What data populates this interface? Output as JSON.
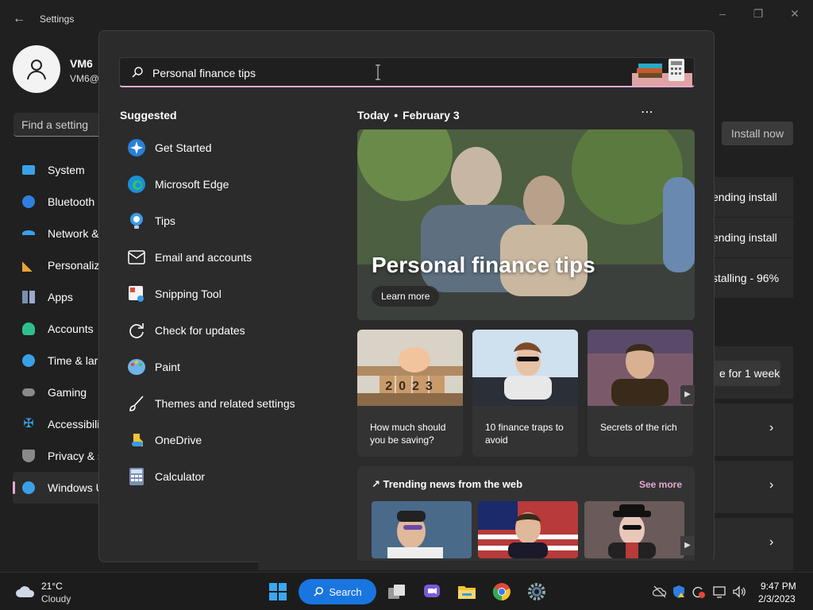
{
  "window": {
    "title": "Settings"
  },
  "user": {
    "name": "VM6",
    "email": "VM6@"
  },
  "find_setting": {
    "placeholder": "Find a setting"
  },
  "nav": {
    "items": [
      {
        "label": "System"
      },
      {
        "label": "Bluetooth"
      },
      {
        "label": "Network &"
      },
      {
        "label": "Personaliz"
      },
      {
        "label": "Apps"
      },
      {
        "label": "Accounts"
      },
      {
        "label": "Time & lar"
      },
      {
        "label": "Gaming"
      },
      {
        "label": "Accessibili"
      },
      {
        "label": "Privacy & s"
      },
      {
        "label": "Windows U"
      }
    ]
  },
  "updates": {
    "install_now": "Install now",
    "status_1": "ending install",
    "status_2": "ending install",
    "status_3": "stalling - 96%",
    "pause_label": "e for 1 week"
  },
  "search": {
    "query": "Personal finance tips",
    "suggested_title": "Suggested",
    "suggested": [
      {
        "label": "Get Started",
        "icon": "get-started-icon"
      },
      {
        "label": "Microsoft Edge",
        "icon": "edge-icon"
      },
      {
        "label": "Tips",
        "icon": "tips-icon"
      },
      {
        "label": "Email and accounts",
        "icon": "mail-icon"
      },
      {
        "label": "Snipping Tool",
        "icon": "snipping-tool-icon"
      },
      {
        "label": "Check for updates",
        "icon": "refresh-icon"
      },
      {
        "label": "Paint",
        "icon": "paint-icon"
      },
      {
        "label": "Themes and related settings",
        "icon": "brush-icon"
      },
      {
        "label": "OneDrive",
        "icon": "onedrive-icon"
      },
      {
        "label": "Calculator",
        "icon": "calculator-icon"
      }
    ],
    "today_label": "Today",
    "date_label": "February 3",
    "hero": {
      "title": "Personal finance tips",
      "button": "Learn more"
    },
    "cards": [
      {
        "text": "How much should you be saving?"
      },
      {
        "text": "10 finance traps to avoid"
      },
      {
        "text": "Secrets of the rich"
      }
    ],
    "piggy_year": "2023",
    "trending_title": "Trending news from the web",
    "see_more": "See more"
  },
  "taskbar": {
    "weather_temp": "21°C",
    "weather_desc": "Cloudy",
    "search_label": "Search",
    "time": "9:47 PM",
    "date": "2/3/2023"
  },
  "colors": {
    "accent": "#e5a9d3",
    "taskbar_search": "#1975e0"
  }
}
